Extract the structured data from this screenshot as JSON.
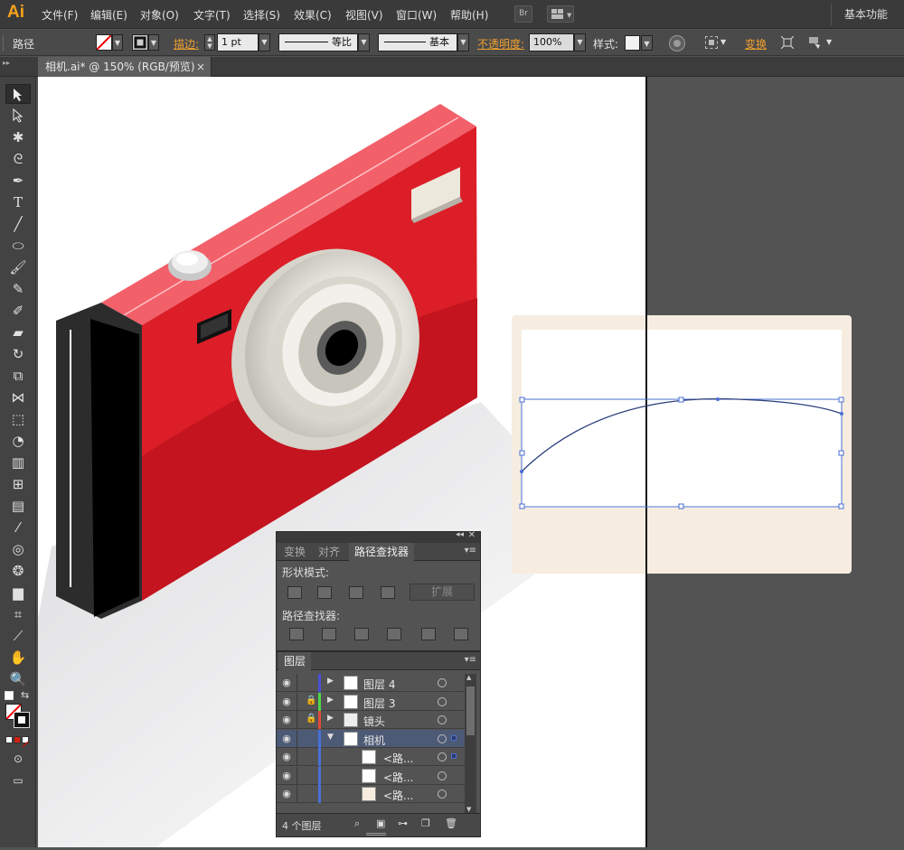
{
  "app": {
    "logo": "Ai",
    "workspace": "基本功能"
  },
  "menu": [
    "文件(F)",
    "编辑(E)",
    "对象(O)",
    "文字(T)",
    "选择(S)",
    "效果(C)",
    "视图(V)",
    "窗口(W)",
    "帮助(H)"
  ],
  "menu_buttons": {
    "bridge": "Br"
  },
  "control": {
    "selection_type": "路径",
    "stroke_label": "描边:",
    "stroke_weight": "1 pt",
    "profile": "等比",
    "brush": "基本",
    "opacity_label": "不透明度:",
    "opacity": "100%",
    "style_label": "样式:",
    "transform_label": "变换"
  },
  "document_tab": {
    "title": "相机.ai* @ 150% (RGB/预览)",
    "close": "×"
  },
  "pathfinder_panel": {
    "tabs": [
      "变换",
      "对齐",
      "路径查找器"
    ],
    "shape_modes_label": "形状模式:",
    "expand_label": "扩展",
    "pathfinders_label": "路径查找器:"
  },
  "layers_panel": {
    "tab": "图层",
    "rows": [
      {
        "name": "图层 4",
        "color": "#4a4fd6",
        "locked": false,
        "expanded": false
      },
      {
        "name": "图层 3",
        "color": "#4ed64a",
        "locked": true,
        "expanded": false
      },
      {
        "name": "镜头",
        "color": "#e04a3a",
        "locked": true,
        "expanded": false
      },
      {
        "name": "相机",
        "color": "#4a6fd6",
        "locked": false,
        "expanded": true
      },
      {
        "name": "<路...",
        "color": "#4a6fd6",
        "locked": false,
        "expanded": false
      },
      {
        "name": "<路...",
        "color": "#4a6fd6",
        "locked": false,
        "expanded": false
      },
      {
        "name": "<路...",
        "color": "#4a6fd6",
        "locked": false,
        "expanded": false
      }
    ],
    "footer": "4 个图层"
  },
  "colors": {
    "accent_orange": "#f0a030",
    "selection_blue": "#4a6fd6",
    "camera_red": "#dc1e28"
  }
}
